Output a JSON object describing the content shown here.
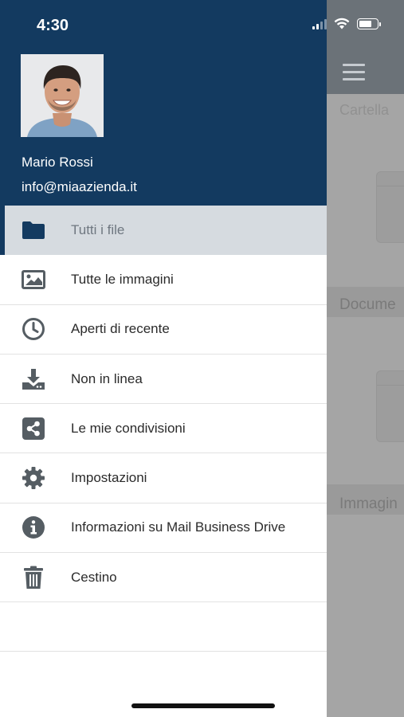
{
  "status_bar": {
    "time": "4:30"
  },
  "background": {
    "sections": [
      "Cartella",
      "Docume",
      "Immagin"
    ]
  },
  "drawer": {
    "user": {
      "name": "Mario Rossi",
      "email": "info@miaazienda.it"
    },
    "menu": [
      {
        "icon": "folder-icon",
        "label": "Tutti i file",
        "active": true
      },
      {
        "icon": "image-icon",
        "label": "Tutte le immagini"
      },
      {
        "icon": "clock-icon",
        "label": "Aperti di recente"
      },
      {
        "icon": "download-icon",
        "label": "Non in linea"
      },
      {
        "icon": "share-icon",
        "label": "Le mie condivisioni"
      },
      {
        "icon": "gear-icon",
        "label": "Impostazioni"
      },
      {
        "icon": "info-icon",
        "label": "Informazioni su Mail Business Drive"
      },
      {
        "icon": "trash-icon",
        "label": "Cestino"
      }
    ]
  },
  "colors": {
    "header": "#133a60",
    "active_row": "#d6dbe0",
    "icon": "#555d63"
  }
}
